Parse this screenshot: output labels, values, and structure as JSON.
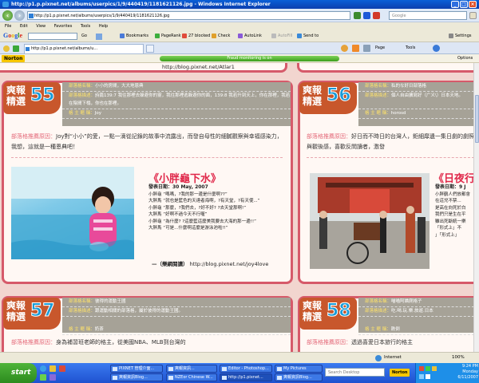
{
  "window": {
    "title": "http://p1.p.pixnet.net/albums/userpics/1/9/440419/1181621126.jpg - Windows Internet Explorer"
  },
  "nav": {
    "address": "http://p1.p.pixnet.net/albums/userpics/1/9/440419/1181621126.jpg",
    "search_placeholder": "Google"
  },
  "menu": [
    "File",
    "Edit",
    "View",
    "Favorites",
    "Tools",
    "Help"
  ],
  "google_toolbar": {
    "logo_letters": [
      "G",
      "o",
      "o",
      "g",
      "l",
      "e"
    ],
    "go_label": "Go",
    "items": [
      "Bookmarks",
      "PageRank",
      "27 blocked",
      "Check",
      "AutoLink",
      "AutoFill",
      "Send to",
      "Settings"
    ]
  },
  "tabs": {
    "active_tab": "http://p1.p.pixnet.net/albums/u...",
    "page_label": "Page",
    "tools_label": "Tools"
  },
  "norton": {
    "logo": "Norton",
    "fraud_status": "Fraud monitoring is on",
    "options": "Options"
  },
  "content": {
    "top_url": "http://blog.pixnet.net/Atlar1",
    "cards": [
      {
        "badge_label": "爽報精選",
        "badge_number": "55",
        "info": [
          {
            "k": "部落格名稱：",
            "v": "小小的房間，大大地恩典"
          },
          {
            "k": "部落格描述：",
            "v": "詩篇139:7 我往那裡去躲避你的靈，我往那裡逃躲避你的面，139:8 我若升到天上，你在那裡，我若在陰間下榻，你也在那裡。"
          },
          {
            "k": "格 主 暱 稱：",
            "v": "Joy"
          }
        ],
        "recommend_key": "部落格推薦原因：",
        "recommend_text": "Joy對“小小”的愛，一點一滴從記錄的故事中流露出，而發自母性的細膩觀察與幸福感染力，我想，這就是一種恩典吧！",
        "post_title": "《小胖龜下水》",
        "post_meta": [
          "發表日期：30 May, 2007",
          "小胖龜 “嗎嗎，?我的那一邊是什麼啊??”",
          "大胖馬 “就也是藍色的天達者海啊，?有天堂，?有天使...”",
          "小胖龜 “那麼，?我們去，?好不好? ?去天堂那啊!”",
          "大胖馬 “好啊不過今天不行喔”",
          "小胖龜 “為什麼? ?這麼藍這麼美我要去大海的那一邊!!”",
          "大胖馬 “可是...什麼啊這麼是游泳池啦!!”"
        ],
        "footer_prefix": "—（樂網閱讀）",
        "footer_url": "http://blog.pixnet.net/joy4love"
      },
      {
        "badge_label": "爽報精選",
        "badge_number": "56",
        "info": [
          {
            "k": "部落格名稱：",
            "v": "私的な好日部落格"
          },
          {
            "k": "部落格描述：",
            "v": "個人自由擴寫好（广义\\）日本天地。"
          },
          {
            "k": "格 主 暱 稱：",
            "v": "horosd"
          }
        ],
        "recommend_key": "部落格推薦原因：",
        "recommend_text": "好日而不時日的台灣人，鉅細靡遺一集日劇的劇照與觀後感，喜歡反問讀者，激發",
        "post_title": "《日夜行",
        "post_meta": [
          "發表日期：9 J",
          "小胖鶴人們放都會",
          "在這兒不禁...",
          "是高在向死於白",
          "我們只是生在平",
          "雖出死斷統一樂",
          "「形式上」不",
          "」「形式上」"
        ]
      },
      {
        "badge_label": "爽報精選",
        "badge_number": "57",
        "info": [
          {
            "k": "部落格名稱：",
            "v": "彼得的運動王國"
          },
          {
            "k": "部落格描述：",
            "v": "跟運動相關的部落格，屬於彼得的運動王國。"
          },
          {
            "k": "格 主 暱 稱：",
            "v": "奶茶"
          }
        ],
        "recommend_key": "部落格推薦原因：",
        "recommend_text": "身為補習班老師的格主，從美國NBA、MLB到台灣的"
      },
      {
        "badge_label": "爽報精選",
        "badge_number": "58",
        "info": [
          {
            "k": "部落格名稱：",
            "v": "喵喵阿嬌爬格子"
          },
          {
            "k": "部落格描述：",
            "v": "吃.喝.玩.樂.旅遊.日本"
          },
          {
            "k": "格 主 暱 稱：",
            "v": "跌倒"
          }
        ],
        "recommend_key": "部落格推薦原因：",
        "recommend_text": "透過喜愛日本旅行的格主"
      }
    ]
  },
  "status": {
    "zone": "Internet",
    "zoom": "100%"
  },
  "taskbar": {
    "start": "start",
    "tasks_top": [
      "PIXNET 管理介面...",
      "爽報資訊...",
      "Editor - Photoshop...",
      "My Pictures"
    ],
    "tasks_bottom": [
      "爽報資訊Blog...",
      "NZEor Chinese W...",
      "http://p1.pixnet...",
      "爽報資訊Blog..."
    ],
    "search_placeholder": "Search Desktop",
    "tray_norton": "Norton",
    "time": "9:24 PM",
    "day": "Monday",
    "date": "6/11/2007"
  }
}
